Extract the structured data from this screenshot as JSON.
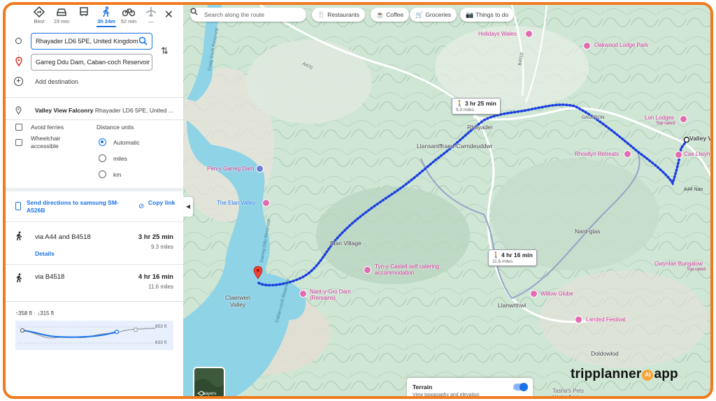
{
  "modes": [
    {
      "id": "best",
      "label": "Best"
    },
    {
      "id": "drive",
      "label": "19 min"
    },
    {
      "id": "transit",
      "label": ""
    },
    {
      "id": "walk",
      "label": "3h 24m",
      "active": true
    },
    {
      "id": "bike",
      "label": "52 min"
    },
    {
      "id": "flight",
      "label": "—"
    }
  ],
  "waypoints": {
    "origin": "Rhayader LD6 5PE, United Kingdom",
    "destination": "Garreg Ddu Dam, Caban-coch Reservoir"
  },
  "add_destination": "Add destination",
  "place": {
    "name": "Valley View Falconry",
    "address": "Rhayader LD6 5PE, United ..."
  },
  "options": {
    "avoid_ferries": "Avoid ferries",
    "wheelchair": "Wheelchair accessible",
    "distance_units_title": "Distance units",
    "units": [
      "Automatic",
      "miles",
      "km"
    ],
    "selected_unit": "Automatic"
  },
  "send": {
    "label": "Send directions to samsung SM-A526B",
    "copy": "Copy link"
  },
  "routes": [
    {
      "via": "via A44 and B4518",
      "time": "3 hr 25 min",
      "distance": "9.3 miles",
      "details": "Details"
    },
    {
      "via": "via B4518",
      "time": "4 hr 16 min",
      "distance": "11.6 miles"
    }
  ],
  "elevation": {
    "summary": "↑358 ft · ↓315 ft",
    "max": "853 ft",
    "min": "633 ft"
  },
  "map_search": {
    "placeholder": "Search along the route"
  },
  "map_chips": [
    "Restaurants",
    "Coffee",
    "Groceries",
    "Things to do"
  ],
  "map_labels": {
    "towns": [
      "Rhayader",
      "Llansantffraed-Cwmdeuddwr",
      "Elan Village",
      "Claerwen Valley",
      "Nant-glas",
      "Llanwrthwl",
      "Doldowlod",
      "GAUFRON"
    ],
    "pois": [
      "Holidays Wales",
      "Oakwood Lodge Park",
      "Lon Lodges",
      "Rhosllyn Retreats",
      "Cae Llwyn",
      "Pen-y Garreg Dam",
      "The Elan Valley",
      "Tyn-y-Castell self catering accommodation",
      "Nant-y-Gro Dam (Remains)",
      "Willow Globe",
      "Landed Festival",
      "Gwynfan Bungalow",
      "Tasha's Pets Home from Home",
      "Valley Vi"
    ],
    "sub": {
      "top_rated": "Top rated"
    },
    "roads": [
      "A470",
      "B4518",
      "A44",
      "A44 Nan",
      "Craig Goch Reservoir",
      "Garreg Ddu Reservoir",
      "Caban-coch Reservoir"
    ]
  },
  "callouts": [
    {
      "time": "3 hr 25 min",
      "dist": "9.3 miles"
    },
    {
      "time": "4 hr 16 min",
      "dist": "11.6 miles"
    }
  ],
  "layers_label": "Layers",
  "terrain": {
    "title": "Terrain",
    "desc": "View topography and elevation"
  },
  "watermark": {
    "left": "tripplanner",
    "mid": "AI",
    "right": "app"
  },
  "colors": {
    "accent": "#1a73e8",
    "route": "#1a3fe0",
    "frame": "#f07a1e",
    "water": "#8fd3e6",
    "land": "#cfe6d5"
  }
}
